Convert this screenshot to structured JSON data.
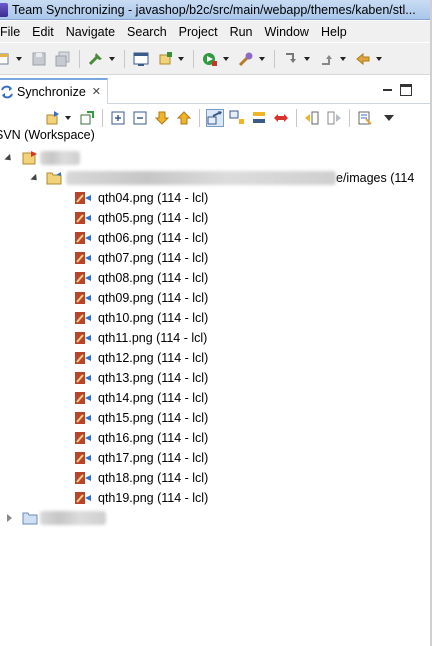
{
  "window": {
    "title": "Team Synchronizing - javashop/b2c/src/main/webapp/themes/kaben/stl..."
  },
  "menu": [
    "File",
    "Edit",
    "Navigate",
    "Search",
    "Project",
    "Run",
    "Window",
    "Help"
  ],
  "view": {
    "tab_label": "Synchronize",
    "scope_label": "SVN (Workspace)"
  },
  "tree": {
    "folder_path_suffix": "e/images (114",
    "files": [
      {
        "name": "qth04.png (114 - lcl)"
      },
      {
        "name": "qth05.png (114 - lcl)"
      },
      {
        "name": "qth06.png (114 - lcl)"
      },
      {
        "name": "qth07.png (114 - lcl)"
      },
      {
        "name": "qth08.png (114 - lcl)"
      },
      {
        "name": "qth09.png (114 - lcl)"
      },
      {
        "name": "qth10.png (114 - lcl)"
      },
      {
        "name": "qth11.png (114 - lcl)"
      },
      {
        "name": "qth12.png (114 - lcl)"
      },
      {
        "name": "qth13.png (114 - lcl)"
      },
      {
        "name": "qth14.png (114 - lcl)"
      },
      {
        "name": "qth15.png (114 - lcl)"
      },
      {
        "name": "qth16.png (114 - lcl)"
      },
      {
        "name": "qth17.png (114 - lcl)"
      },
      {
        "name": "qth18.png (114 - lcl)"
      },
      {
        "name": "qth19.png (114 - lcl)"
      }
    ]
  },
  "icons": {
    "outgoing_file": "outgoing-change-icon",
    "folder": "folder-icon",
    "project": "project-icon"
  }
}
